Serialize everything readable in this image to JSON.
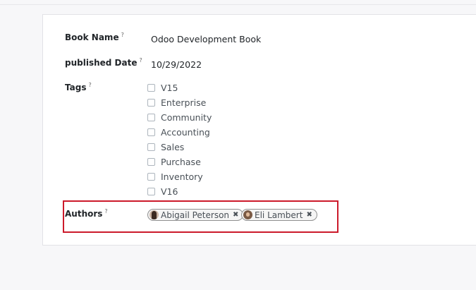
{
  "form": {
    "book_name": {
      "label": "Book Name",
      "help": "?",
      "value": "Odoo Development Book"
    },
    "published_date": {
      "label": "published Date",
      "help": "?",
      "value": "10/29/2022"
    },
    "tags": {
      "label": "Tags",
      "help": "?",
      "options": [
        {
          "label": "V15",
          "checked": false
        },
        {
          "label": "Enterprise",
          "checked": false
        },
        {
          "label": "Community",
          "checked": false
        },
        {
          "label": "Accounting",
          "checked": false
        },
        {
          "label": "Sales",
          "checked": false
        },
        {
          "label": "Purchase",
          "checked": false
        },
        {
          "label": "Inventory",
          "checked": false
        },
        {
          "label": "V16",
          "checked": false
        }
      ]
    },
    "authors": {
      "label": "Authors",
      "help": "?",
      "chips": [
        {
          "name": "Abigail Peterson",
          "remove_icon": "✖"
        },
        {
          "name": "Eli Lambert",
          "remove_icon": "✖"
        }
      ]
    }
  },
  "colors": {
    "highlight": "#cc1a2b"
  }
}
